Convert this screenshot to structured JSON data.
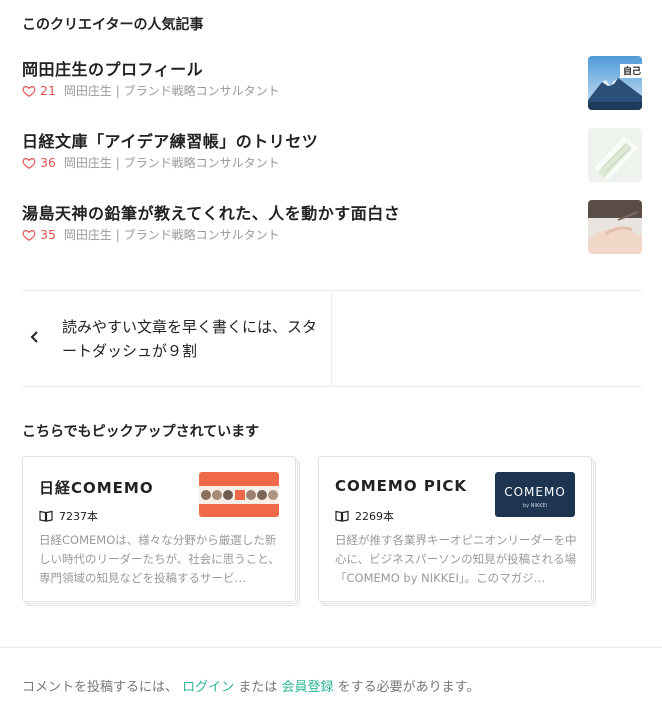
{
  "popular": {
    "heading": "このクリエイターの人気記事",
    "articles": [
      {
        "title": "岡田庄生のプロフィール",
        "likes": "21",
        "author": "岡田庄生 | ブランド戦略コンサルタント",
        "thumb_text": "自己"
      },
      {
        "title": "日経文庫「アイデア練習帳」のトリセツ",
        "likes": "36",
        "author": "岡田庄生 | ブランド戦略コンサルタント"
      },
      {
        "title": "湯島天神の鉛筆が教えてくれた、人を動かす面白さ",
        "likes": "35",
        "author": "岡田庄生 | ブランド戦略コンサルタント"
      }
    ]
  },
  "prev_article": {
    "title": "読みやすい文章を早く書くには、スタートダッシュが９割"
  },
  "picked": {
    "heading": "こちらでもピックアップされています",
    "magazines": [
      {
        "name": "日経COMEMO",
        "count": "7237本",
        "description": "日経COMEMOは、様々な分野から厳選した新しい時代のリーダーたちが、社会に思うこと、専門領域の知見などを投稿するサービ…"
      },
      {
        "name": "COMEMO PICK",
        "count": "2269本",
        "description": "日経が推す各業界キーオピニオンリーダーを中心に、ビジネスパーソンの知見が投稿される場「COMEMO by NIKKEI」。このマガジ…",
        "thumb_logo": "COMEMO",
        "thumb_sub": "by NIKKEI"
      }
    ]
  },
  "comment": {
    "prefix": "コメントを投稿するには、",
    "login": "ログイン",
    "middle": "または",
    "signup": "会員登録",
    "suffix": "をする必要があります。"
  },
  "colors": {
    "like_red": "#e35353",
    "link_green": "#2cb696",
    "comemo_orange": "#f06a4a",
    "comemo_navy": "#1e3552"
  }
}
